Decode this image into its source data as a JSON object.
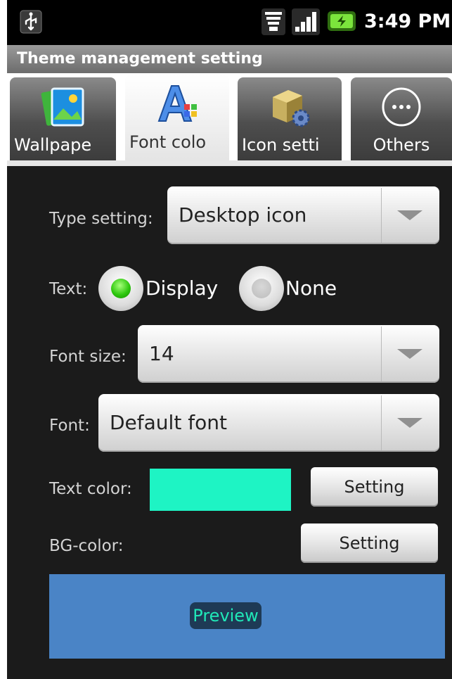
{
  "status_bar": {
    "time": "3:49 PM",
    "icons": [
      "usb-icon",
      "wifi-icon",
      "signal-icon",
      "battery-charging-icon"
    ]
  },
  "title_bar": {
    "title": "Theme management setting"
  },
  "tabs": [
    {
      "label": "Wallpape",
      "icon": "wallpaper-icon",
      "selected": false
    },
    {
      "label": "Font colo",
      "icon": "font-color-icon",
      "selected": true
    },
    {
      "label": "Icon setti",
      "icon": "icon-setting-icon",
      "selected": false
    },
    {
      "label": "Others",
      "icon": "ellipsis-circle-icon",
      "selected": false
    }
  ],
  "form": {
    "type_setting": {
      "label": "Type setting:",
      "value": "Desktop icon"
    },
    "text": {
      "label": "Text:",
      "options": [
        {
          "label": "Display",
          "selected": true
        },
        {
          "label": "None",
          "selected": false
        }
      ]
    },
    "font_size": {
      "label": "Font size:",
      "value": "14"
    },
    "font": {
      "label": "Font:",
      "value": "Default font"
    },
    "text_color": {
      "label": "Text color:",
      "swatch_color": "#1ef4c4",
      "button_label": "Setting"
    },
    "bg_color": {
      "label": "BG-color:",
      "button_label": "Setting"
    }
  },
  "preview": {
    "text": "Preview",
    "background_color": "#4a84c6",
    "text_color": "#20e8b8"
  }
}
